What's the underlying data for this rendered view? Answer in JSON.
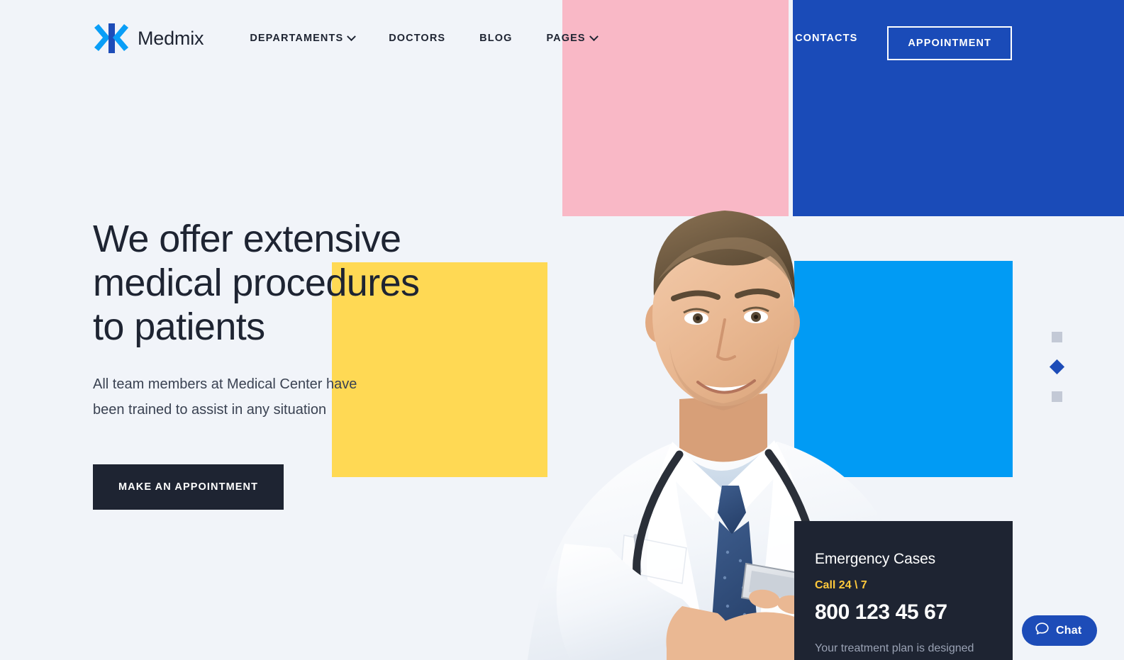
{
  "brand": {
    "name": "Medmix",
    "logo_icon": "chevrons-logo-icon"
  },
  "header": {
    "nav_items": [
      {
        "label": "DEPARTAMENTS",
        "has_dropdown": true,
        "icon": "chevron-down-icon"
      },
      {
        "label": "DOCTORS",
        "has_dropdown": false,
        "icon": ""
      },
      {
        "label": "BLOG",
        "has_dropdown": false,
        "icon": ""
      },
      {
        "label": "PAGES",
        "has_dropdown": true,
        "icon": "chevron-down-icon"
      }
    ],
    "contacts_label": "CONTACTS",
    "appointment_label": "APPOINTMENT"
  },
  "hero": {
    "title": "We offer extensive\nmedical procedures\nto patients",
    "subtitle": "All team members at Medical Center have\nbeen trained to assist in any situation",
    "cta_label": "MAKE AN APPOINTMENT"
  },
  "emergency": {
    "title": "Emergency Cases",
    "call_label": "Call 24 \\ 7",
    "phone": "800 123 45 67",
    "note": "Your treatment plan is designed"
  },
  "slider": {
    "dots": [
      {
        "state": "inactive",
        "shape": "square"
      },
      {
        "state": "active",
        "shape": "diamond"
      },
      {
        "state": "inactive",
        "shape": "square"
      }
    ]
  },
  "chat": {
    "label": "Chat",
    "icon": "speech-bubble-icon"
  },
  "colors": {
    "page_background": "#f1f4f9",
    "brand_navy": "#1d4cb8",
    "brand_light_blue": "#019bf4",
    "block_pink": "#f9b8c6",
    "block_yellow": "#ffd954",
    "dark": "#1e2432",
    "accent_yellow_text": "#ffc93c"
  }
}
